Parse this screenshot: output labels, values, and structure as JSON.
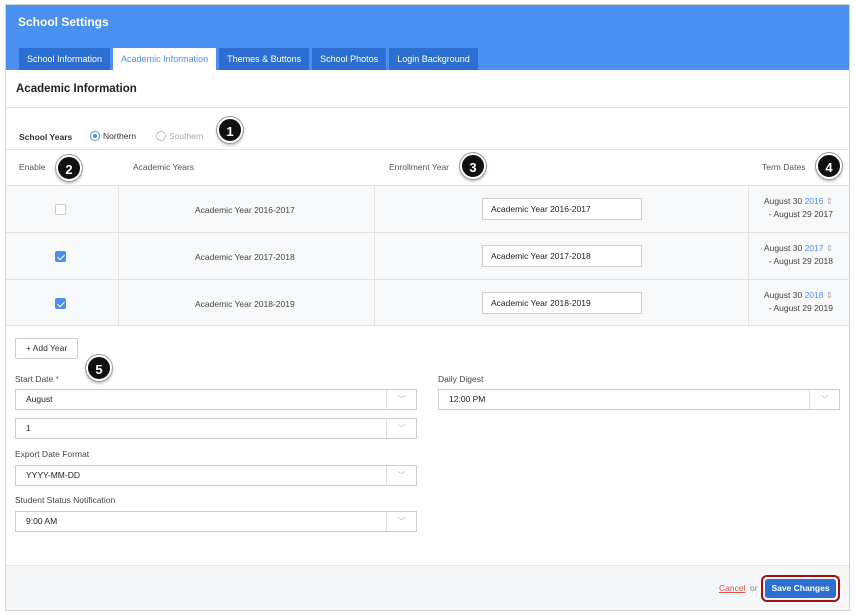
{
  "header": {
    "title": "School Settings"
  },
  "tabs": [
    {
      "label": "School Information",
      "active": false
    },
    {
      "label": "Academic Information",
      "active": true
    },
    {
      "label": "Themes & Buttons",
      "active": false
    },
    {
      "label": "School Photos",
      "active": false
    },
    {
      "label": "Login Background",
      "active": false
    }
  ],
  "section_title": "Academic Information",
  "school_years": {
    "label": "School Years",
    "options": [
      {
        "label": "Northern",
        "selected": true
      },
      {
        "label": "Southern",
        "selected": false
      }
    ]
  },
  "table": {
    "headers": {
      "enable": "Enable",
      "academic_years": "Academic Years",
      "enrollment_year": "Enrollment Year",
      "term_dates": "Term Dates"
    },
    "rows": [
      {
        "enabled": false,
        "academic_year": "Academic Year 2016-2017",
        "enrollment_year": "Academic Year 2016-2017",
        "term_start": "August 30",
        "term_year": "2016",
        "term_end": "- August 29 2017"
      },
      {
        "enabled": true,
        "academic_year": "Academic Year 2017-2018",
        "enrollment_year": "Academic Year 2017-2018",
        "term_start": "August 30",
        "term_year": "2017",
        "term_end": "- August 29 2018"
      },
      {
        "enabled": true,
        "academic_year": "Academic Year 2018-2019",
        "enrollment_year": "Academic Year 2018-2019",
        "term_start": "August 30",
        "term_year": "2018",
        "term_end": "- August 29 2019"
      }
    ]
  },
  "add_year": {
    "label": "+ Add Year"
  },
  "form": {
    "start_date": {
      "label": "Start Date",
      "required_mark": "*",
      "month": "August",
      "day": "1"
    },
    "daily_digest": {
      "label": "Daily Digest",
      "value": "12:00 PM"
    },
    "export_date_format": {
      "label": "Export Date Format",
      "value": "YYYY-MM-DD"
    },
    "student_status_notification": {
      "label": "Student Status Notification",
      "value": "9:00 AM"
    }
  },
  "footer": {
    "cancel": "Cancel",
    "or": "or",
    "save": "Save Changes"
  },
  "callouts": [
    "1",
    "2",
    "3",
    "4",
    "5"
  ],
  "icons": {
    "sort": "⇕",
    "chevron": "﹀"
  },
  "colors": {
    "brand": "#4a90f0",
    "tab_bg": "#2d6fd1",
    "cancel": "#d9534f",
    "save_highlight": "#a01010"
  }
}
